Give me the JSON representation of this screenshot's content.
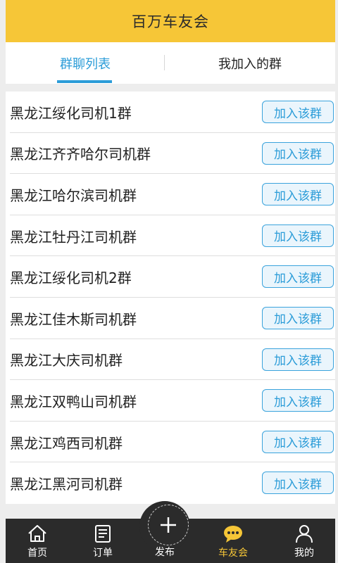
{
  "header": {
    "title": "百万车友会"
  },
  "tabs": [
    {
      "label": "群聊列表",
      "active": true
    },
    {
      "label": "我加入的群",
      "active": false
    }
  ],
  "groups": [
    {
      "name": "黑龙江绥化司机1群",
      "action": "加入该群"
    },
    {
      "name": "黑龙江齐齐哈尔司机群",
      "action": "加入该群"
    },
    {
      "name": "黑龙江哈尔滨司机群",
      "action": "加入该群"
    },
    {
      "name": "黑龙江牡丹江司机群",
      "action": "加入该群"
    },
    {
      "name": "黑龙江绥化司机2群",
      "action": "加入该群"
    },
    {
      "name": "黑龙江佳木斯司机群",
      "action": "加入该群"
    },
    {
      "name": "黑龙江大庆司机群",
      "action": "加入该群"
    },
    {
      "name": "黑龙江双鸭山司机群",
      "action": "加入该群"
    },
    {
      "name": "黑龙江鸡西司机群",
      "action": "加入该群"
    },
    {
      "name": "黑龙江黑河司机群",
      "action": "加入该群"
    }
  ],
  "nav": {
    "home": {
      "label": "首页",
      "icon": "home-icon"
    },
    "order": {
      "label": "订单",
      "icon": "order-icon"
    },
    "publish": {
      "label": "发布",
      "icon": "plus-icon"
    },
    "chat": {
      "label": "车友会",
      "icon": "chat-bubble-icon",
      "active": true
    },
    "mine": {
      "label": "我的",
      "icon": "user-icon"
    }
  },
  "colors": {
    "header": "#f6c637",
    "accent": "#2b9cd8",
    "nav_bg": "#2b2b2b",
    "nav_active": "#f6c637"
  }
}
